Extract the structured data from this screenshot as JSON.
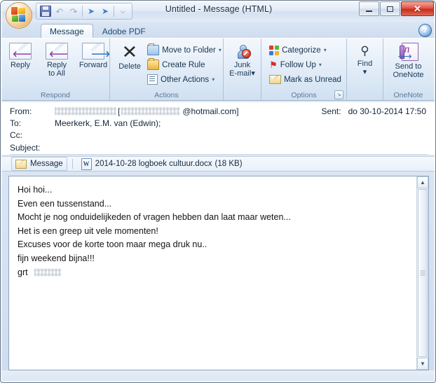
{
  "window": {
    "title": "Untitled - Message (HTML)",
    "office_button": "office-orb",
    "controls": {
      "minimize": "_",
      "maximize": "□",
      "close": "✕"
    },
    "quick_access": [
      {
        "name": "save",
        "glyph": "save"
      },
      {
        "name": "undo",
        "glyph": "↶"
      },
      {
        "name": "redo",
        "glyph": "↷"
      },
      {
        "name": "previous-item",
        "glyph": "◆"
      },
      {
        "name": "next-item",
        "glyph": "◆"
      },
      {
        "name": "customize-quick-access-toolbar",
        "glyph": "⌵"
      }
    ]
  },
  "tabs": [
    {
      "label": "Message",
      "active": true
    },
    {
      "label": "Adobe PDF",
      "active": false
    }
  ],
  "help_button": "?",
  "ribbon": {
    "groups": [
      {
        "title": "Respond",
        "buttons": [
          {
            "label_line1": "Reply",
            "label_line2": "",
            "icon": "reply-icon"
          },
          {
            "label_line1": "Reply",
            "label_line2": "to All",
            "icon": "reply-all-icon"
          },
          {
            "label_line1": "Forward",
            "label_line2": "",
            "icon": "forward-icon"
          }
        ]
      },
      {
        "title": "Actions",
        "big": {
          "label_line1": "Delete",
          "icon": "delete-icon"
        },
        "small": [
          {
            "label": "Move to Folder",
            "caret": "▾",
            "icon": "move-to-folder-icon"
          },
          {
            "label": "Create Rule",
            "caret": "",
            "icon": "create-rule-icon"
          },
          {
            "label": "Other Actions",
            "caret": "▾",
            "icon": "other-actions-icon"
          }
        ]
      },
      {
        "title": "",
        "big": {
          "label_line1": "Junk",
          "label_line2": "E-mail",
          "caret": "▾",
          "icon": "junk-email-icon"
        }
      },
      {
        "title": "Options",
        "small": [
          {
            "label": "Categorize",
            "caret": "▾",
            "icon": "categorize-icon"
          },
          {
            "label": "Follow Up",
            "caret": "▾",
            "icon": "follow-up-flag-icon"
          },
          {
            "label": "Mark as Unread",
            "caret": "",
            "icon": "mark-as-unread-icon"
          }
        ],
        "dialog_launcher": "↘"
      },
      {
        "title": "",
        "big": {
          "label_line1": "Find",
          "label_line2": "",
          "caret": "▾",
          "icon": "find-icon"
        }
      },
      {
        "title": "OneNote",
        "big": {
          "label_line1": "Send to",
          "label_line2": "OneNote",
          "icon": "onenote-icon"
        }
      }
    ]
  },
  "header": {
    "from_label": "From:",
    "from_name_redacted": true,
    "from_email_domain": "@hotmail.com]",
    "from_bracket_open": "[",
    "to_label": "To:",
    "to_value": "Meerkerk, E.M. van (Edwin);",
    "cc_label": "Cc:",
    "cc_value": "",
    "subject_label": "Subject:",
    "subject_value": "",
    "sent_label": "Sent:",
    "sent_value": "do 30-10-2014 17:50"
  },
  "attachments": {
    "message_tab": "Message",
    "items": [
      {
        "name": "2014-10-28 logboek cultuur.docx",
        "size": "(18 KB)",
        "icon": "word-document-icon"
      }
    ]
  },
  "body": {
    "lines": [
      "Hoi hoi...",
      "Even een tussenstand...",
      "Mocht je nog onduidelijkeden of vragen hebben dan laat maar weten...",
      "Het is een greep uit vele momenten!",
      "Excuses voor de korte toon maar mega druk nu..",
      "fijn weekend bijna!!!"
    ],
    "signature_prefix": "grt",
    "signature_redacted": true
  },
  "scrollbar": {
    "up_arrow": "▲",
    "down_arrow": "▼"
  },
  "colors": {
    "titlebar_text": "#1d2d40",
    "close_button": "#c62d1c",
    "ribbon_group_label": "#5a7896",
    "tab_active_text": "#12395c",
    "body_text": "#141414"
  }
}
